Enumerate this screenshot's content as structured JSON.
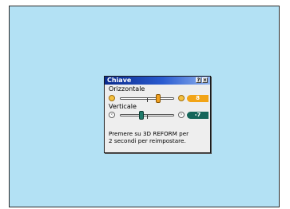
{
  "dialog": {
    "title": "Chiave",
    "help_icon": "help-icon",
    "close_icon": "close-icon"
  },
  "horizontal": {
    "label": "Orizzontale",
    "value": "8",
    "min_icon": "circle-icon",
    "max_icon": "circle-icon"
  },
  "vertical": {
    "label": "Verticale",
    "value": "-7",
    "min_icon": "arrow-left-icon",
    "max_icon": "arrow-right-icon"
  },
  "message": {
    "line1": "Premere su 3D REFORM per",
    "line2": "2 secondi per reimpostare."
  },
  "colors": {
    "background": "#b3e1f4",
    "accent_orange": "#f2a417",
    "accent_green": "#15665a",
    "titlebar_start": "#0a2a8c",
    "titlebar_end": "#8fb2ee"
  }
}
